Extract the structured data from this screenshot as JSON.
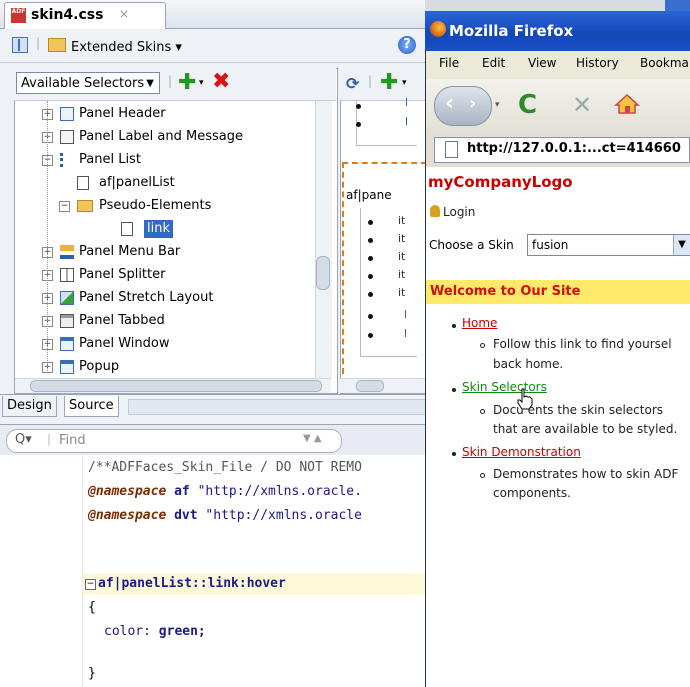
{
  "ide": {
    "file_tab": {
      "label": "skin4.css",
      "icon": "ADF",
      "close": "×"
    },
    "extended_skins": "Extended Skins ▾",
    "help": "?",
    "selector_dropdown": "Available Selectors",
    "tree": [
      {
        "label": "Panel Header"
      },
      {
        "label": "Panel Label and Message"
      },
      {
        "label": "Panel List"
      },
      {
        "label": "af|panelList"
      },
      {
        "label": "Pseudo-Elements"
      },
      {
        "label": "link"
      },
      {
        "label": "Panel Menu Bar"
      },
      {
        "label": "Panel Splitter"
      },
      {
        "label": "Panel Stretch Layout"
      },
      {
        "label": "Panel Tabbed"
      },
      {
        "label": "Panel Window"
      },
      {
        "label": "Popup"
      }
    ],
    "preview": {
      "label": "af|pane",
      "items": [
        "it",
        "it",
        "it",
        "it",
        "it",
        "l",
        "l"
      ]
    },
    "tabs": {
      "design": "Design",
      "source": "Source"
    },
    "find_placeholder": "Find",
    "code": {
      "line1": "/**ADFFaces_Skin_File / DO NOT REMO",
      "ns1_kw": "@namespace",
      "ns1_prefix": "af",
      "ns1_url": "\"http://xmlns.oracle.",
      "ns2_kw": "@namespace",
      "ns2_prefix": "dvt",
      "ns2_url": "\"http://xmlns.oracle",
      "selector": "af|panelList::link:hover",
      "open": "{",
      "prop": "color:",
      "val": "green;",
      "close": "}"
    }
  },
  "firefox": {
    "title": "Mozilla Firefox",
    "menu": [
      "File",
      "Edit",
      "View",
      "History",
      "Bookma"
    ],
    "url": "http://127.0.0.1:...ct=414660",
    "logo": "myCompanyLogo",
    "login": "Login",
    "choose_skin_label": "Choose a Skin",
    "skin_value": "fusion",
    "welcome": "Welcome to Our Site",
    "items": [
      {
        "link": "Home",
        "desc1": "Follow this link to find yoursel",
        "desc2": "back home."
      },
      {
        "link": "Skin Selectors",
        "desc1": "Docu  ents the skin selectors",
        "desc2": "that are available to be styled."
      },
      {
        "link": "Skin Demonstration",
        "desc1": "Demonstrates how to skin ADF",
        "desc2": "components."
      }
    ]
  }
}
